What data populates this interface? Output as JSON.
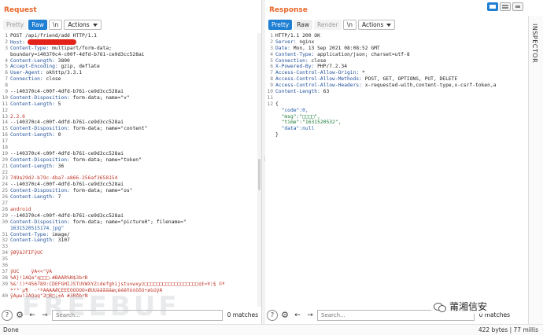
{
  "request": {
    "title": "Request",
    "tabs": [
      "Pretty",
      "Raw",
      "\\n",
      "Actions"
    ],
    "active_tab": "Raw",
    "lines": [
      {
        "n": "1",
        "k": "",
        "v": "POST /api/friend/add HTTP/1.1"
      },
      {
        "n": "2",
        "k": "Host:",
        "v": ""
      },
      {
        "n": "3",
        "k": "Content-Type:",
        "v": " multipart/form-data;"
      },
      {
        "n": "",
        "k": "",
        "v": "boundary=i40370c4-c00f-4dfd-b761-ce9d3cc528ai"
      },
      {
        "n": "4",
        "k": "Content-Length:",
        "v": " 3800"
      },
      {
        "n": "5",
        "k": "Accept-Encoding:",
        "v": " gzip, deflate"
      },
      {
        "n": "6",
        "k": "User-Agent:",
        "v": " okhttp/3.3.1"
      },
      {
        "n": "7",
        "k": "Connection:",
        "v": " close"
      },
      {
        "n": "8",
        "k": "",
        "v": ""
      },
      {
        "n": "9",
        "k": "",
        "v": "--i40370c4-c00f-4dfd-b761-ce9d3cc528ai"
      },
      {
        "n": "10",
        "k": "Content-Disposition:",
        "v": " form-data; name=\"v\""
      },
      {
        "n": "11",
        "k": "Content-Length:",
        "v": " 5"
      },
      {
        "n": "12",
        "k": "",
        "v": ""
      },
      {
        "n": "13",
        "k": "",
        "v": "2.2.6",
        "c": "red"
      },
      {
        "n": "14",
        "k": "",
        "v": "--i40370c4-c00f-4dfd-b761-ce9d3cc528ai"
      },
      {
        "n": "15",
        "k": "Content-Disposition:",
        "v": " form-data; name=\"content\""
      },
      {
        "n": "16",
        "k": "Content-Length:",
        "v": " 0"
      },
      {
        "n": "17",
        "k": "",
        "v": ""
      },
      {
        "n": "18",
        "k": "",
        "v": ""
      },
      {
        "n": "19",
        "k": "",
        "v": "--i40370c4-c00f-4dfd-b761-ce9d3cc528ai"
      },
      {
        "n": "20",
        "k": "Content-Disposition:",
        "v": " form-data; name=\"token\""
      },
      {
        "n": "21",
        "k": "Content-Length:",
        "v": " 36"
      },
      {
        "n": "22",
        "k": "",
        "v": ""
      },
      {
        "n": "23",
        "k": "",
        "v": "749a29d2-b79c-4ba7-a866-256af3658154",
        "c": "red"
      },
      {
        "n": "24",
        "k": "",
        "v": "--i40370c4-c00f-4dfd-b761-ce9d3cc528ai"
      },
      {
        "n": "25",
        "k": "Content-Disposition:",
        "v": " form-data; name=\"os\""
      },
      {
        "n": "26",
        "k": "Content-Length:",
        "v": " 7"
      },
      {
        "n": "27",
        "k": "",
        "v": ""
      },
      {
        "n": "28",
        "k": "",
        "v": "android",
        "c": "red"
      },
      {
        "n": "29",
        "k": "",
        "v": "--i40370c4-c00f-4dfd-b761-ce9d3cc528ai"
      },
      {
        "n": "30",
        "k": "Content-Disposition:",
        "v": " form-data; name=\"picture0\"; filename=\""
      },
      {
        "n": "",
        "k": "",
        "v": "1631520515174.jpg\"",
        "c": "blue"
      },
      {
        "n": "31",
        "k": "Content-Type:",
        "v": " image/"
      },
      {
        "n": "32",
        "k": "Content-Length:",
        "v": " 3107"
      },
      {
        "n": "33",
        "k": "",
        "v": ""
      },
      {
        "n": "34",
        "k": "",
        "v": "ÿØÿàJFIFÿÛC",
        "c": "red"
      },
      {
        "n": "35",
        "k": "",
        "v": ""
      },
      {
        "n": "36",
        "k": "",
        "v": ""
      },
      {
        "n": "37",
        "k": "",
        "v": "ÿÛC    ÿÀ<<\"ÿÄ",
        "c": "red"
      },
      {
        "n": "38",
        "k": "",
        "v": "%Ä}!1AQa\"q□□□.#BÄAR%Ñ$3brÐ",
        "c": "red"
      },
      {
        "n": "39",
        "k": "",
        "v": "%&'()*456789:CDEFGHIJSTUVWXYZcdefghijstuvwxyz□□□□□□□□□□□□□□□□□□¢£¤¥¦§ ©ª",
        "c": "red"
      },
      {
        "n": "",
        "k": "",
        "v": "*²³´µ¶  ·¹ºÂÃÄÅÆÇÈÉÊÒÓÔÕÖ×ØÙÚáâãäåæçèéêñòóôõö÷øùúÿÄ",
        "c": "red"
      },
      {
        "n": "40",
        "k": "",
        "v": "ÿÄµw!1AQaq\"2□B□¡±Á #3RðbrÑ",
        "c": "red"
      }
    ],
    "search_placeholder": "Search...",
    "matches": "0 matches"
  },
  "response": {
    "title": "Response",
    "tabs": [
      "Pretty",
      "Raw",
      "Render",
      "\\n",
      "Actions"
    ],
    "active_tab": "Pretty",
    "lines": [
      {
        "n": "1",
        "k": "",
        "v": "HTTP/1.1 200 OK"
      },
      {
        "n": "2",
        "k": "Server:",
        "v": " nginx"
      },
      {
        "n": "3",
        "k": "Date:",
        "v": " Mon, 13 Sep 2021 08:08:52 GMT"
      },
      {
        "n": "4",
        "k": "Content-Type:",
        "v": " application/json; charset=utf-8"
      },
      {
        "n": "5",
        "k": "Connection:",
        "v": " close"
      },
      {
        "n": "6",
        "k": "X-Powered-By:",
        "v": " PHP/7.2.34"
      },
      {
        "n": "7",
        "k": "Access-Control-Allow-Origin:",
        "v": " *"
      },
      {
        "n": "8",
        "k": "Access-Control-Allow-Methods:",
        "v": " POST, GET, OPTIONS, PUT, DELETE"
      },
      {
        "n": "9",
        "k": "Access-Control-Allow-Headers:",
        "v": " x-requested-with,content-type,x-csrf-token,a"
      },
      {
        "n": "10",
        "k": "Content-Length:",
        "v": " 63"
      },
      {
        "n": "11",
        "k": "",
        "v": ""
      },
      {
        "n": "12",
        "k": "",
        "v": "{"
      },
      {
        "n": "",
        "k": "",
        "v": "  \"code\":0,",
        "c": "json-blue"
      },
      {
        "n": "",
        "k": "",
        "v": "  \"msg\":\"□□□□\",",
        "c": "json-mix"
      },
      {
        "n": "",
        "k": "",
        "v": "  \"time\":\"1631520532\",",
        "c": "json-mix"
      },
      {
        "n": "",
        "k": "",
        "v": "  \"data\":null",
        "c": "json-blue"
      },
      {
        "n": "",
        "k": "",
        "v": "}"
      }
    ],
    "search_placeholder": "Search...",
    "matches": "0 matches"
  },
  "inspector_label": "INSPECTOR",
  "status": {
    "left": "Done",
    "right": "422 bytes | 77 millis"
  },
  "watermark": "FREEBUF",
  "brand_name": "莆湘信安",
  "colors": {
    "accent": "#1f7fd3",
    "title": "#e8672a",
    "header_key": "#1f4f9a",
    "body_value": "#c0392b",
    "redaction": "#e3221a"
  }
}
